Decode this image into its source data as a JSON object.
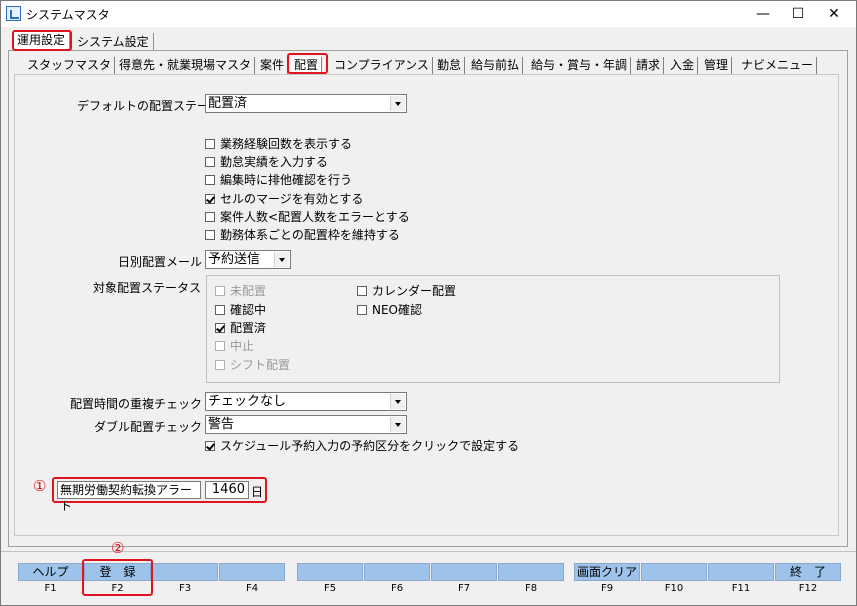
{
  "window": {
    "title": "システムマスタ",
    "minimize": "—",
    "maximize": "☐",
    "close": "✕"
  },
  "outer_tabs": [
    "運用設定",
    "システム設定"
  ],
  "inner_tabs": [
    "スタッフマスタ",
    "得意先・就業現場マスタ",
    "案件",
    "配置",
    "コンプライアンス",
    "勤怠",
    "給与前払",
    "給与・賞与・年調",
    "請求",
    "入金",
    "管理",
    "ナビメニュー"
  ],
  "form": {
    "default_status_label": "デフォルトの配置ステータス",
    "default_status_value": "配置済",
    "options": [
      {
        "label": "業務経験回数を表示する",
        "checked": false
      },
      {
        "label": "勤怠実績を入力する",
        "checked": false
      },
      {
        "label": "編集時に排他確認を行う",
        "checked": false
      },
      {
        "label": "セルのマージを有効とする",
        "checked": true
      },
      {
        "label": "案件人数<配置人数をエラーとする",
        "checked": false
      },
      {
        "label": "勤務体系ごとの配置枠を維持する",
        "checked": false
      }
    ],
    "daily_mail_label": "日別配置メール",
    "daily_mail_value": "予約送信",
    "target_status_label": "対象配置ステータス",
    "statuses_left": [
      {
        "label": "未配置",
        "checked": false,
        "disabled": true
      },
      {
        "label": "確認中",
        "checked": false,
        "disabled": false
      },
      {
        "label": "配置済",
        "checked": true,
        "disabled": false
      },
      {
        "label": "中止",
        "checked": false,
        "disabled": true
      },
      {
        "label": "シフト配置",
        "checked": false,
        "disabled": true
      }
    ],
    "statuses_right": [
      {
        "label": "カレンダー配置",
        "checked": false,
        "disabled": false
      },
      {
        "label": "NEO確認",
        "checked": false,
        "disabled": false
      }
    ],
    "overlap_label": "配置時間の重複チェック",
    "overlap_value": "チェックなし",
    "double_label": "ダブル配置チェック",
    "double_value": "警告",
    "schedule_option": {
      "label": "スケジュール予約入力の予約区分をクリックで設定する",
      "checked": true
    },
    "alert_label": "無期労働契約転換アラート",
    "alert_value": "1460",
    "alert_unit": "日"
  },
  "annotations": {
    "one": "①",
    "two": "②"
  },
  "function_keys": [
    {
      "label": "ヘルプ",
      "code": "F1"
    },
    {
      "label": "登　録",
      "code": "F2"
    },
    {
      "label": "",
      "code": "F3"
    },
    {
      "label": "",
      "code": "F4"
    },
    {
      "label": "",
      "code": "F5"
    },
    {
      "label": "",
      "code": "F6"
    },
    {
      "label": "",
      "code": "F7"
    },
    {
      "label": "",
      "code": "F8"
    },
    {
      "label": "画面クリア",
      "code": "F9"
    },
    {
      "label": "",
      "code": "F10"
    },
    {
      "label": "",
      "code": "F11"
    },
    {
      "label": "終　了",
      "code": "F12"
    }
  ],
  "colors": {
    "accent": "#e0141e",
    "fkey": "#9dc3ea"
  }
}
